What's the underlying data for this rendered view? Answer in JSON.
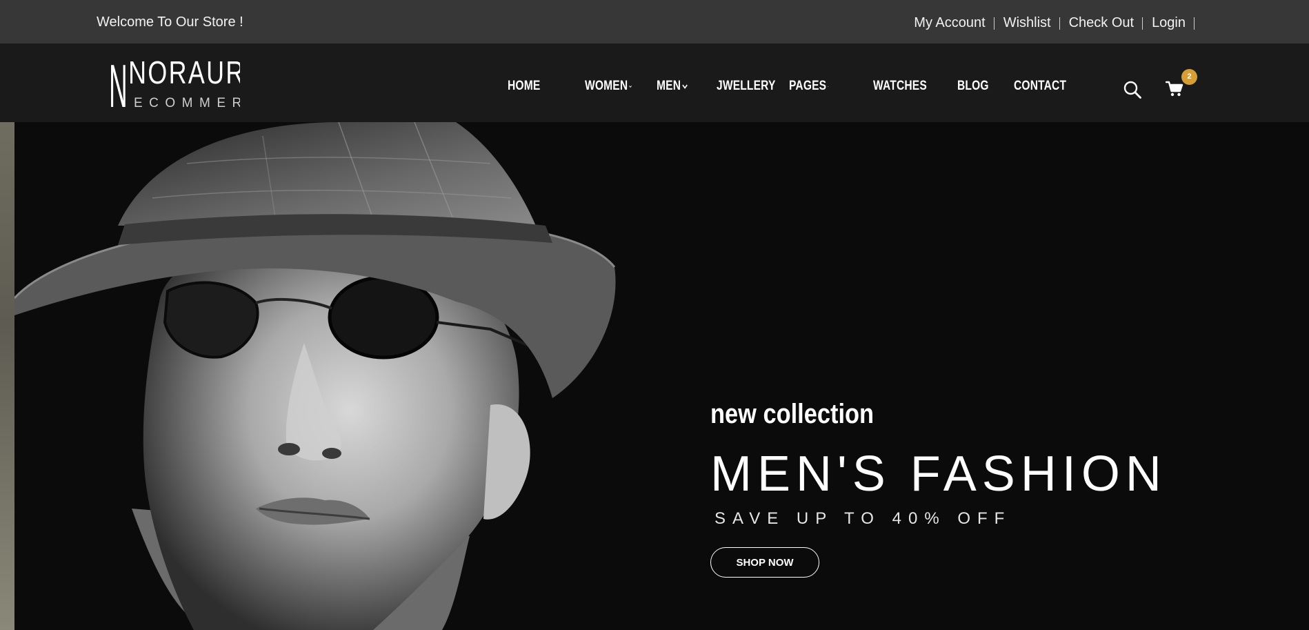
{
  "topbar": {
    "welcome": "Welcome To Our Store !",
    "links": [
      {
        "label": "My Account"
      },
      {
        "label": "Wishlist"
      },
      {
        "label": "Check Out"
      },
      {
        "label": "Login"
      }
    ]
  },
  "header": {
    "logo": {
      "main": "NORAURE",
      "sub": "ECOMMERCE"
    },
    "nav": [
      {
        "label": "HOME",
        "dropdown": true
      },
      {
        "label": "WOMEN",
        "dropdown": true
      },
      {
        "label": "MEN",
        "dropdown": true
      },
      {
        "label": "JWELLERY",
        "dropdown": false
      },
      {
        "label": "PAGES",
        "dropdown": true
      },
      {
        "label": "WATCHES",
        "dropdown": false
      },
      {
        "label": "BLOG",
        "dropdown": false
      },
      {
        "label": "CONTACT",
        "dropdown": false
      }
    ],
    "icons": {
      "search": "search-icon",
      "cart": "cart-icon"
    },
    "cart_count": "2"
  },
  "hero": {
    "tag": "new collection",
    "title": "MEN'S FASHION",
    "subtitle": "SAVE UP TO 40% OFF",
    "button": "SHOP NOW"
  },
  "colors": {
    "topbar_bg": "#373737",
    "header_bg": "#1a1a1a",
    "hero_bg": "#0b0b0b",
    "badge": "#d69f35"
  }
}
